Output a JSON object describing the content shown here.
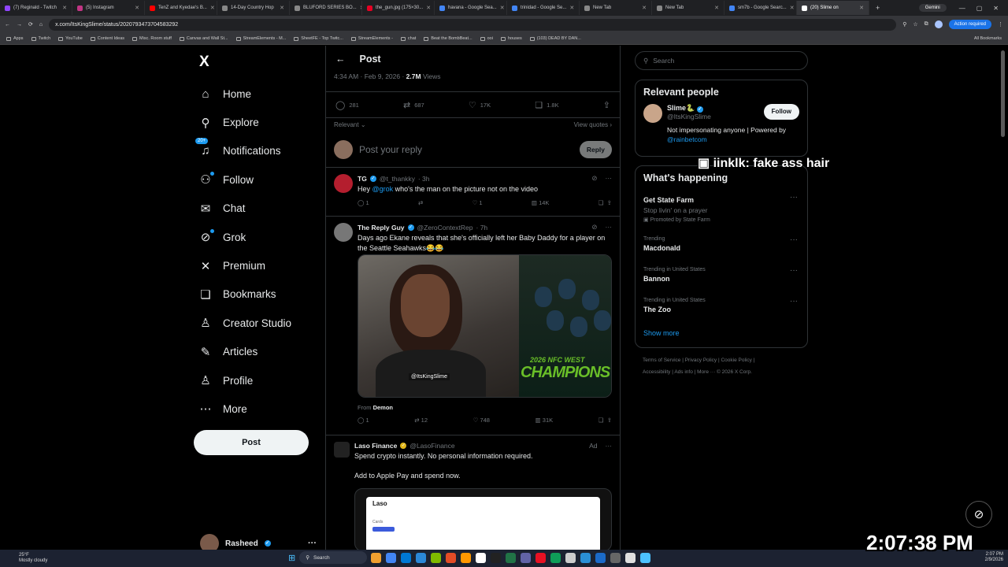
{
  "browser": {
    "tabs": [
      {
        "label": "(7) Reginald - Twitch",
        "color": "#9146ff"
      },
      {
        "label": "(5) Instagram",
        "color": "#c13584"
      },
      {
        "label": "TenZ and Kyedae's B...",
        "color": "#ff0000"
      },
      {
        "label": "14-Day Country Hop",
        "color": "#888888"
      },
      {
        "label": "BLUFORD SERIES BO...",
        "color": "#888888"
      },
      {
        "label": "the_gun.jpg (175×30...",
        "color": "#e60023"
      },
      {
        "label": "havana - Google Sea...",
        "color": "#4285f4"
      },
      {
        "label": "trinidad - Google Se...",
        "color": "#4285f4"
      },
      {
        "label": "New Tab",
        "color": "#888888"
      },
      {
        "label": "New Tab",
        "color": "#888888"
      },
      {
        "label": "sm7b - Google Searc...",
        "color": "#4285f4"
      },
      {
        "label": "(20) Slime on",
        "color": "#ffffff"
      }
    ],
    "gemini_label": "Gemini",
    "url": "x.com/ItsKingSlime/status/2020793473704583292",
    "action_required": "Action required",
    "bookmarks": [
      "Apps",
      "Twitch",
      "YouTube",
      "Content Ideas",
      "Misc. Room stuff",
      "Canvas and Wall St...",
      "StreamElements - M...",
      "SheetFE - Top Twitc...",
      "StreamElements -",
      "chat",
      "Beat the BombBeat...",
      "ooi",
      "houses",
      "(103) DEAD BY DAN..."
    ],
    "all_bookmarks": "All Bookmarks"
  },
  "sidebar": {
    "logo": "X",
    "items": [
      {
        "label": "Home",
        "icon": "⌂"
      },
      {
        "label": "Explore",
        "icon": "⚲"
      },
      {
        "label": "Notifications",
        "icon": "♫",
        "badge": "20+"
      },
      {
        "label": "Follow",
        "icon": "⚇"
      },
      {
        "label": "Chat",
        "icon": "✉"
      },
      {
        "label": "Grok",
        "icon": "⊘"
      },
      {
        "label": "Premium",
        "icon": "✕"
      },
      {
        "label": "Bookmarks",
        "icon": "❏"
      },
      {
        "label": "Creator Studio",
        "icon": "♙"
      },
      {
        "label": "Articles",
        "icon": "✎"
      },
      {
        "label": "Profile",
        "icon": "♙"
      },
      {
        "label": "More",
        "icon": "⋯"
      }
    ],
    "post_label": "Post",
    "account_name": "Rasheed"
  },
  "post": {
    "header_title": "Post",
    "time": "4:34 AM · Feb 9, 2026 · ",
    "views_count": "2.7M",
    "views_label": " Views",
    "stats": {
      "replies": "281",
      "reposts": "687",
      "likes": "17K",
      "bookmarks": "1.8K"
    },
    "relevant_label": "Relevant",
    "view_quotes": "View quotes",
    "reply_placeholder": "Post your reply",
    "reply_button": "Reply"
  },
  "replies": [
    {
      "name": "TG",
      "handle": "@t_thankky",
      "time": "· 3h",
      "text_pre": "Hey ",
      "mention": "@grok",
      "text_post": " who's the man on the picture not on the video",
      "replies": "1",
      "reposts": "",
      "likes": "1",
      "views": "14K"
    },
    {
      "name": "The Reply Guy",
      "handle": "@ZeroContextRep",
      "time": "· 7h",
      "text": "Days ago Ekane reveals that she's officially left her Baby Daddy for a player on the Seattle Seahawks😂😂",
      "watermark": "@ItsKingSlime",
      "nfc_top": "2026 NFC WEST",
      "nfc_bottom": "CHAMPIONS",
      "from_label": "From ",
      "from_name": "Demon",
      "replies": "1",
      "reposts": "12",
      "likes": "748",
      "views": "31K"
    },
    {
      "name": "Laso Finance",
      "handle": "@LasoFinance",
      "ad": "Ad",
      "text1": "Spend crypto instantly. No personal information required.",
      "text2": "Add to Apple Pay and spend now.",
      "app_title": "Laso",
      "app_caption": "Cards"
    }
  ],
  "right": {
    "search_placeholder": "Search",
    "relevant_title": "Relevant people",
    "person": {
      "name": "Slime🐍",
      "handle": "@ItsKingSlime",
      "follow": "Follow",
      "bio": "Not impersonating anyone | Powered by ",
      "bio_link": "@rainbetcom"
    },
    "happening_title": "What's happening",
    "trends": [
      {
        "category": "",
        "title": "Get State Farm",
        "subtitle": "Stop livin' on a prayer",
        "promo": "Promoted by State Farm"
      },
      {
        "category": "Trending",
        "title": "Macdonald"
      },
      {
        "category": "Trending in United States",
        "title": "Bannon"
      },
      {
        "category": "Trending in United States",
        "title": "The Zoo"
      }
    ],
    "show_more": "Show more",
    "footer_line1": "Terms of Service  |  Privacy Policy  |  Cookie Policy  |",
    "footer_line2": "Accessibility  |  Ads info  |  More ···  © 2026 X Corp."
  },
  "overlay": {
    "chat_text": "iinklk:  fake ass hair"
  },
  "stream_clock": "2:07:38 PM",
  "taskbar": {
    "temp": "25°F",
    "weather": "Mostly cloudy",
    "search": "Search",
    "time": "2:07 PM",
    "date": "2/9/2026"
  }
}
